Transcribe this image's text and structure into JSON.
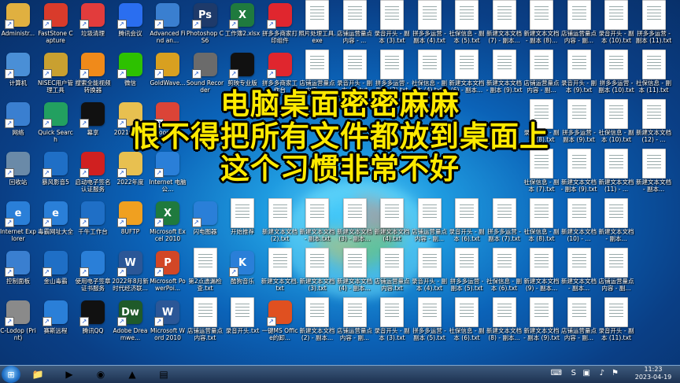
{
  "overlay": {
    "line1": "电脑桌面密密麻麻",
    "line2": "恨不得把所有文件都放到桌面上",
    "line3": "这个习惯非常不好",
    "color": "#ffea00"
  },
  "desktop_icons": [
    {
      "label": "Administr...",
      "icon": "user-folder-icon",
      "kind": "app",
      "color": "#e0b040"
    },
    {
      "label": "FastStone Capture",
      "icon": "faststone-icon",
      "kind": "app",
      "color": "#d93b2b"
    },
    {
      "label": "垃圾清理",
      "icon": "cleanup-icon",
      "kind": "app",
      "color": "#e23c3c"
    },
    {
      "label": "腾讯会议",
      "icon": "tencent-meeting-icon",
      "kind": "app",
      "color": "#2a6ef0"
    },
    {
      "label": "Advanced Find an...",
      "icon": "magnifier-icon",
      "kind": "app",
      "color": "#3a7fd0"
    },
    {
      "label": "Photoshop CS6",
      "icon": "photoshop-icon",
      "kind": "app",
      "color": "#1e3a6a",
      "text": "Ps"
    },
    {
      "label": "工作簿2.xlsx",
      "icon": "excel-file-icon",
      "kind": "app",
      "color": "#1f7a3e",
      "text": "X"
    },
    {
      "label": "拼多多商家打印组件",
      "icon": "pinduoduo-icon",
      "kind": "app",
      "color": "#e0262e"
    },
    {
      "label": "照片处理工具.exe",
      "icon": "file-icon",
      "kind": "txt"
    },
    {
      "label": "店铺运营量点内容 - ...",
      "icon": "text-file-icon",
      "kind": "txt"
    },
    {
      "label": "录音开头 - 副本 (3).txt",
      "icon": "text-file-icon",
      "kind": "txt"
    },
    {
      "label": "拼多多运营 - 副本 (4).txt",
      "icon": "text-file-icon",
      "kind": "txt"
    },
    {
      "label": "社保信息 - 副本 (5).txt",
      "icon": "text-file-icon",
      "kind": "txt"
    },
    {
      "label": "新建文本文档 (7) - 副本...",
      "icon": "text-file-icon",
      "kind": "txt"
    },
    {
      "label": "新建文本文档 - 副本 (8)...",
      "icon": "text-file-icon",
      "kind": "txt"
    },
    {
      "label": "店铺运营量点内容 - 副...",
      "icon": "text-file-icon",
      "kind": "txt"
    },
    {
      "label": "录音开头 - 副本 (10).txt",
      "icon": "text-file-icon",
      "kind": "txt"
    },
    {
      "label": "拼多多运营 - 副本 (11).txt",
      "icon": "text-file-icon",
      "kind": "txt"
    },
    {
      "label": "计算机",
      "icon": "computer-icon",
      "kind": "app",
      "color": "#4a8fd6"
    },
    {
      "label": "NISEC用户管理工具",
      "icon": "key-icon",
      "kind": "app",
      "color": "#c9a030"
    },
    {
      "label": "搜索全能视频转换器",
      "icon": "video-converter-icon",
      "kind": "app",
      "color": "#f08a1a"
    },
    {
      "label": "微信",
      "icon": "wechat-icon",
      "kind": "app",
      "color": "#2dc100"
    },
    {
      "label": "GoldWave...",
      "icon": "goldwave-icon",
      "kind": "app",
      "color": "#d8a020"
    },
    {
      "label": "Sound Recorder",
      "icon": "microphone-icon",
      "kind": "app",
      "color": "#6b6b6b"
    },
    {
      "label": "剪映专业版",
      "icon": "capcut-icon",
      "kind": "app",
      "color": "#111111"
    },
    {
      "label": "拼多多商家工作台",
      "icon": "pinduoduo-icon",
      "kind": "app",
      "color": "#e0262e"
    },
    {
      "label": "店铺运营量点内容 - ...",
      "icon": "text-file-icon",
      "kind": "txt"
    },
    {
      "label": "录音开头 - 副本 (2).txt",
      "icon": "text-file-icon",
      "kind": "txt"
    },
    {
      "label": "拼多多运营 - 副本 (3).txt",
      "icon": "text-file-icon",
      "kind": "txt"
    },
    {
      "label": "社保信息 - 副本 (4).txt",
      "icon": "text-file-icon",
      "kind": "txt"
    },
    {
      "label": "新建文本文档 (6) - 副本...",
      "icon": "text-file-icon",
      "kind": "txt"
    },
    {
      "label": "新建文本文档 - 副本 (9).txt",
      "icon": "text-file-icon",
      "kind": "txt"
    },
    {
      "label": "店铺运营量点内容 - 副...",
      "icon": "text-file-icon",
      "kind": "txt"
    },
    {
      "label": "录音开头 - 副本 (9).txt",
      "icon": "text-file-icon",
      "kind": "txt"
    },
    {
      "label": "拼多多运营 - 副本 (10).txt",
      "icon": "text-file-icon",
      "kind": "txt"
    },
    {
      "label": "社保信息 - 副本 (11).txt",
      "icon": "text-file-icon",
      "kind": "txt"
    },
    {
      "label": "网络",
      "icon": "network-icon",
      "kind": "app",
      "color": "#3a7fd0"
    },
    {
      "label": "Quick Search",
      "icon": "quick-search-icon",
      "kind": "app",
      "color": "#22a060"
    },
    {
      "label": "幕享",
      "icon": "screen-share-icon",
      "kind": "app",
      "color": "#111111"
    },
    {
      "label": "2021年年度",
      "icon": "folder-icon",
      "kind": "app",
      "color": "#e8c050"
    },
    {
      "label": "Google...",
      "icon": "chrome-icon",
      "kind": "app",
      "color": "#db4437"
    },
    {
      "label": "",
      "icon": "blank-icon",
      "kind": "none"
    },
    {
      "label": "",
      "icon": "blank-icon",
      "kind": "none"
    },
    {
      "label": "",
      "icon": "blank-icon",
      "kind": "none"
    },
    {
      "label": "",
      "icon": "blank-icon",
      "kind": "none"
    },
    {
      "label": "",
      "icon": "blank-icon",
      "kind": "none"
    },
    {
      "label": "",
      "icon": "blank-icon",
      "kind": "none"
    },
    {
      "label": "",
      "icon": "blank-icon",
      "kind": "none"
    },
    {
      "label": "",
      "icon": "blank-icon",
      "kind": "none"
    },
    {
      "label": "",
      "icon": "blank-icon",
      "kind": "none"
    },
    {
      "label": "录音开头 - 副本 (8).txt",
      "icon": "text-file-icon",
      "kind": "txt"
    },
    {
      "label": "拼多多运营 - 副本 (9).txt",
      "icon": "text-file-icon",
      "kind": "txt"
    },
    {
      "label": "社保信息 - 副本 (10).txt",
      "icon": "text-file-icon",
      "kind": "txt"
    },
    {
      "label": "新建文本文档 (12) - ...",
      "icon": "text-file-icon",
      "kind": "txt"
    },
    {
      "label": "回收站",
      "icon": "recycle-bin-icon",
      "kind": "app",
      "color": "#6a8aa8"
    },
    {
      "label": "暴风影音5",
      "icon": "media-player-icon",
      "kind": "app",
      "color": "#1f6fc6"
    },
    {
      "label": "启动电子签名认证服务",
      "icon": "seal-icon",
      "kind": "app",
      "color": "#d02020"
    },
    {
      "label": "2022年度",
      "icon": "folder-icon",
      "kind": "app",
      "color": "#e8c050"
    },
    {
      "label": "Internet 电脑公...",
      "icon": "ie-icon",
      "kind": "app",
      "color": "#2a7fd8"
    },
    {
      "label": "",
      "icon": "blank-icon",
      "kind": "none"
    },
    {
      "label": "",
      "icon": "blank-icon",
      "kind": "none"
    },
    {
      "label": "",
      "icon": "blank-icon",
      "kind": "none"
    },
    {
      "label": "",
      "icon": "blank-icon",
      "kind": "none"
    },
    {
      "label": "",
      "icon": "blank-icon",
      "kind": "none"
    },
    {
      "label": "",
      "icon": "blank-icon",
      "kind": "none"
    },
    {
      "label": "",
      "icon": "blank-icon",
      "kind": "none"
    },
    {
      "label": "",
      "icon": "blank-icon",
      "kind": "none"
    },
    {
      "label": "",
      "icon": "blank-icon",
      "kind": "none"
    },
    {
      "label": "社保信息 - 副本 (7).txt",
      "icon": "text-file-icon",
      "kind": "txt"
    },
    {
      "label": "新建文本文档 - 副本 (9).txt",
      "icon": "text-file-icon",
      "kind": "txt"
    },
    {
      "label": "新建文本文档 (11) - ...",
      "icon": "text-file-icon",
      "kind": "txt"
    },
    {
      "label": "新建文本文档 - 副本...",
      "icon": "text-file-icon",
      "kind": "txt"
    },
    {
      "label": "Internet Explorer",
      "icon": "ie-icon",
      "kind": "app",
      "color": "#2a7fd8",
      "text": "e"
    },
    {
      "label": "毒霸网址大全",
      "icon": "browser-icon",
      "kind": "app",
      "color": "#2a7fd8",
      "text": "e"
    },
    {
      "label": "千牛工作台",
      "icon": "qianniu-icon",
      "kind": "app",
      "color": "#1f6fc6"
    },
    {
      "label": "8UFTP",
      "icon": "ftp-icon",
      "kind": "app",
      "color": "#f0a020"
    },
    {
      "label": "Microsoft Excel 2010",
      "icon": "excel-icon",
      "kind": "app",
      "color": "#1f7a3e",
      "text": "X"
    },
    {
      "label": "闪电图器",
      "icon": "tool-icon",
      "kind": "app",
      "color": "#2a7fd8"
    },
    {
      "label": "开始推荐",
      "icon": "text-file-icon",
      "kind": "txt"
    },
    {
      "label": "新建文本文档 (2).txt",
      "icon": "text-file-icon",
      "kind": "txt"
    },
    {
      "label": "新建文本文档 - 副本.txt",
      "icon": "text-file-icon",
      "kind": "txt"
    },
    {
      "label": "新建文本文档 (3) - 副本...",
      "icon": "text-file-icon",
      "kind": "txt"
    },
    {
      "label": "新建文本文档 (4).txt",
      "icon": "text-file-icon",
      "kind": "txt"
    },
    {
      "label": "店铺运营量点内容 - 副...",
      "icon": "text-file-icon",
      "kind": "txt"
    },
    {
      "label": "录音开头 - 副本 (6).txt",
      "icon": "text-file-icon",
      "kind": "txt"
    },
    {
      "label": "拼多多运营 - 副本 (7).txt",
      "icon": "text-file-icon",
      "kind": "txt"
    },
    {
      "label": "社保信息 - 副本 (8).txt",
      "icon": "text-file-icon",
      "kind": "txt"
    },
    {
      "label": "新建文本文档 (10) - ...",
      "icon": "text-file-icon",
      "kind": "txt"
    },
    {
      "label": "新建文本文档 - 副本...",
      "icon": "text-file-icon",
      "kind": "txt"
    },
    {
      "label": "",
      "icon": "blank-icon",
      "kind": "none"
    },
    {
      "label": "控制面板",
      "icon": "control-panel-icon",
      "kind": "app",
      "color": "#3a7fd0"
    },
    {
      "label": "金山毒霸",
      "icon": "duba-icon",
      "kind": "app",
      "color": "#1f6fc6"
    },
    {
      "label": "使用电子签章证书服务",
      "icon": "cert-icon",
      "kind": "app",
      "color": "#2a7fd8"
    },
    {
      "label": "2022年8月新时代经济联...",
      "icon": "word-file-icon",
      "kind": "app",
      "color": "#2b5797",
      "text": "W"
    },
    {
      "label": "Microsoft PowerPoi...",
      "icon": "powerpoint-icon",
      "kind": "app",
      "color": "#d24726",
      "text": "P"
    },
    {
      "label": "第2点遗漏检查.txt",
      "icon": "text-file-icon",
      "kind": "txt"
    },
    {
      "label": "酷狗音乐",
      "icon": "kugou-icon",
      "kind": "app",
      "color": "#2a7fd8",
      "text": "K"
    },
    {
      "label": "新建文本文档.txt",
      "icon": "text-file-icon",
      "kind": "txt"
    },
    {
      "label": "新建文本文档 (3).txt",
      "icon": "text-file-icon",
      "kind": "txt"
    },
    {
      "label": "新建文本文档 (4) - 副本...",
      "icon": "text-file-icon",
      "kind": "txt"
    },
    {
      "label": "店铺运营量点内容.txt",
      "icon": "text-file-icon",
      "kind": "txt"
    },
    {
      "label": "录音开头 - 副本 (4).txt",
      "icon": "text-file-icon",
      "kind": "txt"
    },
    {
      "label": "拼多多运营 - 副本 (5).txt",
      "icon": "text-file-icon",
      "kind": "txt"
    },
    {
      "label": "社保信息 - 副本 (6).txt",
      "icon": "text-file-icon",
      "kind": "txt"
    },
    {
      "label": "新建文本文档 (9) - 副本...",
      "icon": "text-file-icon",
      "kind": "txt"
    },
    {
      "label": "新建文本文档 - 副本...",
      "icon": "text-file-icon",
      "kind": "txt"
    },
    {
      "label": "店铺运营量点内容 - 副...",
      "icon": "text-file-icon",
      "kind": "txt"
    },
    {
      "label": "",
      "icon": "blank-icon",
      "kind": "none"
    },
    {
      "label": "C-Lodop (Print)",
      "icon": "printer-icon",
      "kind": "app",
      "color": "#8a8a8a"
    },
    {
      "label": "赛斯远程",
      "icon": "remote-icon",
      "kind": "app",
      "color": "#2a7fd8"
    },
    {
      "label": "腾讯QQ",
      "icon": "qq-icon",
      "kind": "app",
      "color": "#111111"
    },
    {
      "label": "Adobe Dreamwe...",
      "icon": "dreamweaver-icon",
      "kind": "app",
      "color": "#1f5a2a",
      "text": "Dw"
    },
    {
      "label": "Microsoft Word 2010",
      "icon": "word-icon",
      "kind": "app",
      "color": "#2b5797",
      "text": "W"
    },
    {
      "label": "店铺运营量点内容.txt",
      "icon": "text-file-icon",
      "kind": "txt"
    },
    {
      "label": "录音开头.txt",
      "icon": "text-file-icon",
      "kind": "txt"
    },
    {
      "label": "一键MS Office的卸...",
      "icon": "office-icon",
      "kind": "app",
      "color": "#e05020"
    },
    {
      "label": "新建文本文档 (2) - 副本...",
      "icon": "text-file-icon",
      "kind": "txt"
    },
    {
      "label": "店铺运营量点内容 - 副...",
      "icon": "text-file-icon",
      "kind": "txt"
    },
    {
      "label": "录音开头 - 副本 (3).txt",
      "icon": "text-file-icon",
      "kind": "txt"
    },
    {
      "label": "拼多多运营 - 副本 (5).txt",
      "icon": "text-file-icon",
      "kind": "txt"
    },
    {
      "label": "社保信息 - 副本 (6).txt",
      "icon": "text-file-icon",
      "kind": "txt"
    },
    {
      "label": "新建文本文档 (8) - 副本...",
      "icon": "text-file-icon",
      "kind": "txt"
    },
    {
      "label": "新建文本文档 - 副本 (9).txt",
      "icon": "text-file-icon",
      "kind": "txt"
    },
    {
      "label": "店铺运营量点内容 - 副...",
      "icon": "text-file-icon",
      "kind": "txt"
    },
    {
      "label": "录音开头 - 副本 (11).txt",
      "icon": "text-file-icon",
      "kind": "txt"
    },
    {
      "label": "",
      "icon": "blank-icon",
      "kind": "none"
    }
  ],
  "taskbar": {
    "start_icon": "windows-logo-icon",
    "pinned": [
      {
        "icon": "windows-explorer-icon",
        "glyph": "📁"
      },
      {
        "icon": "media-player-icon",
        "glyph": "▶"
      },
      {
        "icon": "chrome-icon",
        "glyph": "◉"
      },
      {
        "icon": "image-viewer-icon",
        "glyph": "▲"
      },
      {
        "icon": "folder-icon",
        "glyph": "▤"
      }
    ],
    "clock_time": "11:23",
    "clock_date": "2023-04-19"
  }
}
